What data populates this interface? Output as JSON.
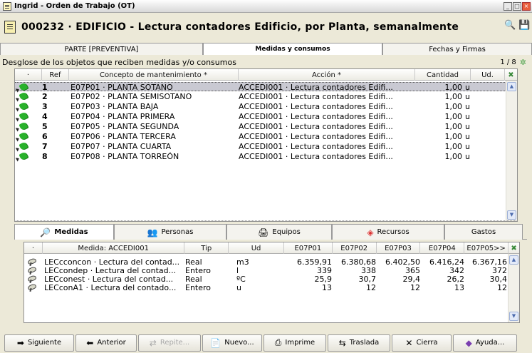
{
  "window": {
    "title": "Ingrid - Orden de Trabajo (OT)",
    "controls": [
      "minimize",
      "maximize",
      "close"
    ]
  },
  "header": {
    "title": "000232 · EDIFICIO - Lectura contadores Edificio, por Planta, semanalmente",
    "icons": [
      "binoculars-icon",
      "save-icon"
    ]
  },
  "top_tabs": [
    {
      "label": "PARTE [PREVENTIVA]",
      "active": false
    },
    {
      "label": "Medidas y consumos",
      "active": true
    },
    {
      "label": "Fechas y Firmas",
      "active": false
    }
  ],
  "breakdown_label": "Desglose de los objetos que reciben medidas y/o consumos",
  "pager": {
    "text": "1 / 8"
  },
  "objects_grid": {
    "headers": {
      "dot": "·",
      "ref": "Ref",
      "concepto": "Concepto de mantenimiento *",
      "accion": "Acción *",
      "cantidad": "Cantidad",
      "ud": "Ud."
    },
    "rows": [
      {
        "num": "1",
        "concepto": "E07P01 · PLANTA SOTANO",
        "accion": "ACCEDI001 · Lectura contadores Edifi...",
        "cantidad": "1,00",
        "ud": "u",
        "selected": true
      },
      {
        "num": "2",
        "concepto": "E07P02 · PLANTA SEMISOTANO",
        "accion": "ACCEDI001 · Lectura contadores Edifi...",
        "cantidad": "1,00",
        "ud": "u"
      },
      {
        "num": "3",
        "concepto": "E07P03 · PLANTA BAJA",
        "accion": "ACCEDI001 · Lectura contadores Edifi...",
        "cantidad": "1,00",
        "ud": "u"
      },
      {
        "num": "4",
        "concepto": "E07P04 · PLANTA PRIMERA",
        "accion": "ACCEDI001 · Lectura contadores Edifi...",
        "cantidad": "1,00",
        "ud": "u"
      },
      {
        "num": "5",
        "concepto": "E07P05 · PLANTA SEGUNDA",
        "accion": "ACCEDI001 · Lectura contadores Edifi...",
        "cantidad": "1,00",
        "ud": "u"
      },
      {
        "num": "6",
        "concepto": "E07P06 · PLANTA TERCERA",
        "accion": "ACCEDI001 · Lectura contadores Edifi...",
        "cantidad": "1,00",
        "ud": "u"
      },
      {
        "num": "7",
        "concepto": "E07P07 · PLANTA CUARTA",
        "accion": "ACCEDI001 · Lectura contadores Edifi...",
        "cantidad": "1,00",
        "ud": "u"
      },
      {
        "num": "8",
        "concepto": "E07P08 · PLANTA TORREÓN",
        "accion": "ACCEDI001 · Lectura contadores Edifi...",
        "cantidad": "1,00",
        "ud": "u"
      }
    ]
  },
  "bottom_tabs": [
    {
      "label": "Medidas",
      "icon": "meter-icon",
      "active": true
    },
    {
      "label": "Personas",
      "icon": "people-icon",
      "active": false
    },
    {
      "label": "Equipos",
      "icon": "equipment-icon",
      "active": false
    },
    {
      "label": "Recursos",
      "icon": "resources-icon",
      "active": false
    },
    {
      "label": "Gastos",
      "icon": "",
      "active": false
    }
  ],
  "measures_grid": {
    "headers": {
      "dot": "·",
      "medida": "Medida: ACCEDI001",
      "tip": "Tip",
      "ud": "Ud",
      "p1": "E07P01",
      "p2": "E07P02",
      "p3": "E07P03",
      "p4": "E07P04",
      "p5": "E07P05>>"
    },
    "rows": [
      {
        "medida": "LECcconcon · Lectura del contad...",
        "tip": "Real",
        "ud": "m3",
        "p1": "6.359,91",
        "p2": "6.380,68",
        "p3": "6.402,50",
        "p4": "6.416,24",
        "p5": "6.367,16"
      },
      {
        "medida": "LECcondep · Lectura del contad...",
        "tip": "Entero",
        "ud": "l",
        "p1": "339",
        "p2": "338",
        "p3": "365",
        "p4": "342",
        "p5": "372"
      },
      {
        "medida": "LECconest · Lectura del contad...",
        "tip": "Real",
        "ud": "ºC",
        "p1": "25,9",
        "p2": "30,7",
        "p3": "29,4",
        "p4": "26,2",
        "p5": "30,4"
      },
      {
        "medida": "LECconA1 · Lectura del contado...",
        "tip": "Entero",
        "ud": "u",
        "p1": "13",
        "p2": "12",
        "p3": "12",
        "p4": "13",
        "p5": "12"
      }
    ]
  },
  "toolbar": [
    {
      "label": "Siguiente",
      "icon": "arrow-right-icon",
      "enabled": true
    },
    {
      "label": "Anterior",
      "icon": "arrow-left-icon",
      "enabled": true
    },
    {
      "label": "Repite...",
      "icon": "repeat-icon",
      "enabled": false
    },
    {
      "label": "Nuevo...",
      "icon": "new-doc-icon",
      "enabled": true
    },
    {
      "label": "Imprime",
      "icon": "printer-icon",
      "enabled": true
    },
    {
      "label": "Traslada",
      "icon": "transfer-icon",
      "enabled": true
    },
    {
      "label": "Cierra",
      "icon": "close-icon",
      "enabled": true
    },
    {
      "label": "Ayuda...",
      "icon": "help-icon",
      "enabled": true
    }
  ]
}
